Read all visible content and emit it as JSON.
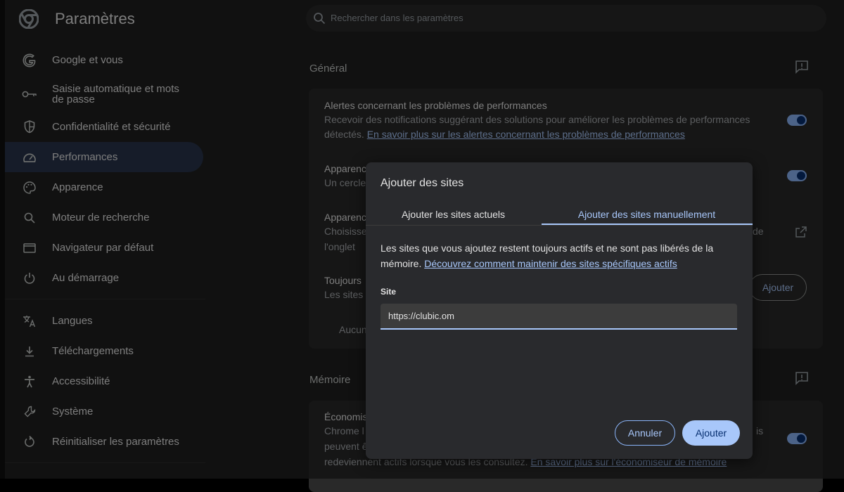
{
  "app": {
    "title": "Paramètres"
  },
  "search": {
    "placeholder": "Rechercher dans les paramètres"
  },
  "sidebar": {
    "items": [
      {
        "label": "Google et vous",
        "icon": "google-icon"
      },
      {
        "label": "Saisie automatique et mots de passe",
        "icon": "key-icon"
      },
      {
        "label": "Confidentialité et sécurité",
        "icon": "shield-icon"
      },
      {
        "label": "Performances",
        "icon": "gauge-icon",
        "active": true
      },
      {
        "label": "Apparence",
        "icon": "palette-icon"
      },
      {
        "label": "Moteur de recherche",
        "icon": "search-icon"
      },
      {
        "label": "Navigateur par défaut",
        "icon": "browser-icon"
      },
      {
        "label": "Au démarrage",
        "icon": "power-icon"
      },
      {
        "label": "Langues",
        "icon": "translate-icon"
      },
      {
        "label": "Téléchargements",
        "icon": "download-icon"
      },
      {
        "label": "Accessibilité",
        "icon": "accessibility-icon"
      },
      {
        "label": "Système",
        "icon": "wrench-icon"
      },
      {
        "label": "Réinitialiser les paramètres",
        "icon": "reset-icon"
      }
    ]
  },
  "general": {
    "title": "Général",
    "alerts_title": "Alertes concernant les problèmes de performances",
    "alerts_desc": "Recevoir des notifications suggérant des solutions pour améliorer les problèmes de performances détectés.",
    "alerts_link": "En savoir plus sur les alertes concernant les problèmes de performances",
    "appear1_title": "Apparenc",
    "appear1_sub": "Un cercle",
    "appear2_title": "Apparenc",
    "appear2_sub1": "Choisisse",
    "appear2_sub1_tail": "de",
    "appear2_sub2": "l'onglet",
    "always_title": "Toujours",
    "always_sub": "Les sites",
    "always_button": "Ajouter",
    "none_text": "Aucun"
  },
  "memory": {
    "title": "Mémoire",
    "eco_title": "Économis",
    "eco_sub1": "Chrome l",
    "eco_sub1_tail": "is",
    "eco_sub2": "peuvent ê",
    "eco_sub3": "redeviennent actifs lorsque vous les consultez.",
    "eco_link": "En savoir plus sur l'économiseur de mémoire"
  },
  "dialog": {
    "title": "Ajouter des sites",
    "tab_current": "Ajouter les sites actuels",
    "tab_manual": "Ajouter des sites manuellement",
    "desc": "Les sites que vous ajoutez restent toujours actifs et ne sont pas libérés de la mémoire.",
    "desc_link": "Découvrez comment maintenir des sites spécifiques actifs",
    "field_label": "Site",
    "field_value": "https://clubic.om",
    "cancel": "Annuler",
    "add": "Ajouter"
  },
  "colors": {
    "accent": "#a8c7fa",
    "active_nav": "#28344b",
    "background": "#1f1f1f",
    "dialog": "#292a2d"
  }
}
